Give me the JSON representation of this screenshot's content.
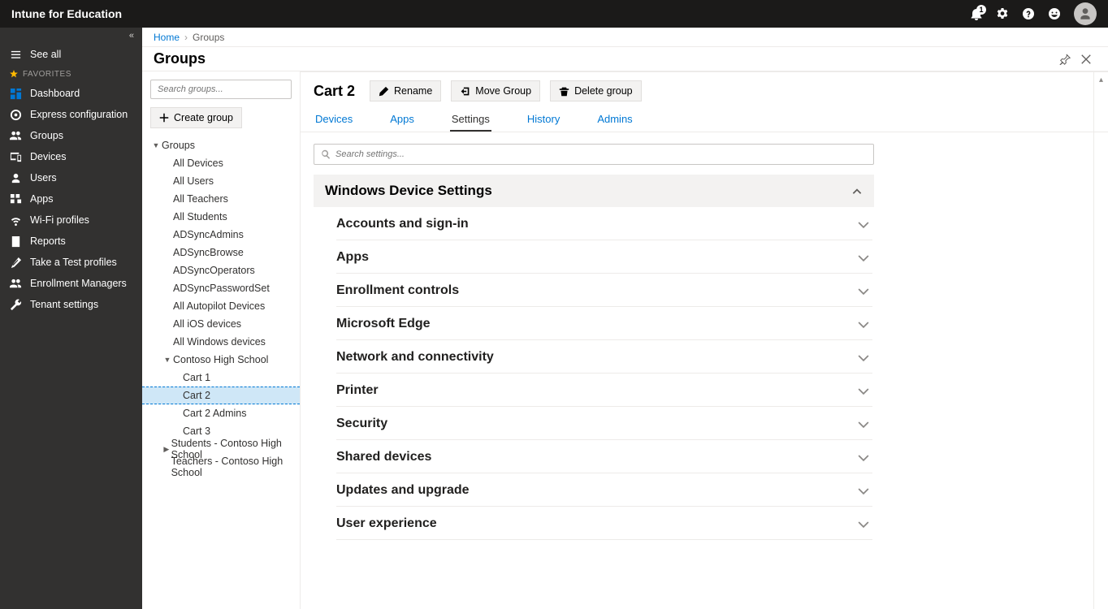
{
  "app_title": "Intune for Education",
  "notif_count": "1",
  "sidebar": {
    "see_all": "See all",
    "fav_label": "FAVORITES",
    "items": [
      {
        "label": "Dashboard"
      },
      {
        "label": "Express configuration"
      },
      {
        "label": "Groups"
      },
      {
        "label": "Devices"
      },
      {
        "label": "Users"
      },
      {
        "label": "Apps"
      },
      {
        "label": "Wi-Fi profiles"
      },
      {
        "label": "Reports"
      },
      {
        "label": "Take a Test profiles"
      },
      {
        "label": "Enrollment Managers"
      },
      {
        "label": "Tenant settings"
      }
    ]
  },
  "breadcrumb": {
    "home": "Home",
    "current": "Groups"
  },
  "page_title": "Groups",
  "groups_blade": {
    "search_placeholder": "Search groups...",
    "create_label": "Create group",
    "root": "Groups",
    "items": [
      "All Devices",
      "All Users",
      "All Teachers",
      "All Students",
      "ADSyncAdmins",
      "ADSyncBrowse",
      "ADSyncOperators",
      "ADSyncPasswordSet",
      "All Autopilot Devices",
      "All iOS devices",
      "All Windows devices"
    ],
    "school": "Contoso High School",
    "school_children": [
      "Cart 1",
      "Cart 2",
      "Cart 2 Admins",
      "Cart 3"
    ],
    "students": "Students - Contoso High School",
    "teachers": "Teachers - Contoso High School",
    "selected": "Cart 2"
  },
  "detail": {
    "title": "Cart 2",
    "actions": {
      "rename": "Rename",
      "move": "Move Group",
      "delete": "Delete group"
    },
    "tabs": [
      "Devices",
      "Apps",
      "Settings",
      "History",
      "Admins"
    ],
    "active_tab": "Settings",
    "search_placeholder": "Search settings...",
    "section": "Windows Device Settings",
    "accordion": [
      "Accounts and sign-in",
      "Apps",
      "Enrollment controls",
      "Microsoft Edge",
      "Network and connectivity",
      "Printer",
      "Security",
      "Shared devices",
      "Updates and upgrade",
      "User experience"
    ]
  }
}
